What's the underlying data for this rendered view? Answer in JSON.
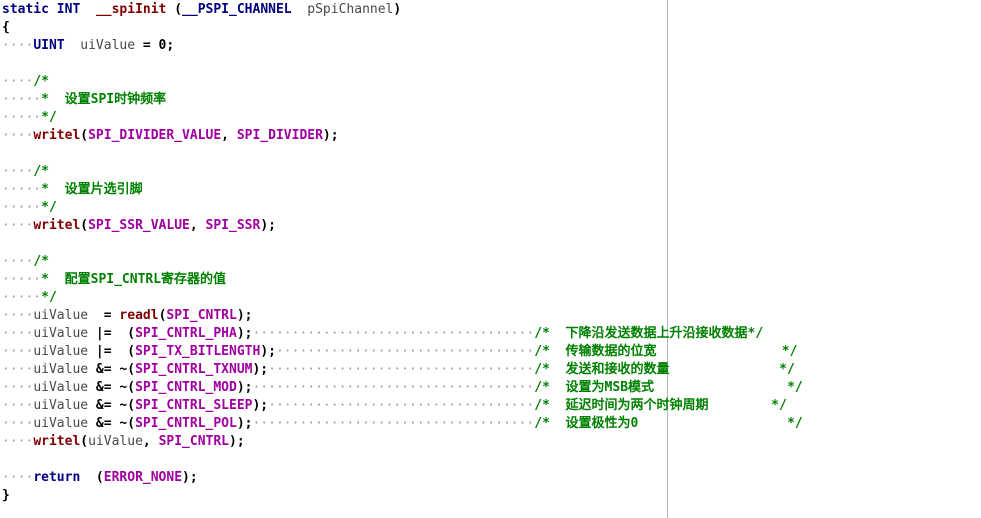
{
  "editor": {
    "lines": [
      {
        "t": [
          {
            "k": "kw",
            "s": "static"
          },
          {
            "k": "op",
            "s": " "
          },
          {
            "k": "kw",
            "s": "INT"
          },
          {
            "k": "op",
            "s": "  "
          },
          {
            "k": "fn",
            "s": "__spiInit"
          },
          {
            "k": "op",
            "s": " ("
          },
          {
            "k": "kw",
            "s": "__PSPI_CHANNEL"
          },
          {
            "k": "op",
            "s": "  "
          },
          {
            "k": "var",
            "s": "pSpiChannel"
          },
          {
            "k": "op",
            "s": ")"
          }
        ]
      },
      {
        "t": [
          {
            "k": "op",
            "s": "{"
          }
        ]
      },
      {
        "t": [
          {
            "k": "dots",
            "s": "····"
          },
          {
            "k": "kw",
            "s": "UINT"
          },
          {
            "k": "op",
            "s": "  "
          },
          {
            "k": "var",
            "s": "uiValue"
          },
          {
            "k": "op",
            "s": " = 0;"
          }
        ]
      },
      {
        "t": []
      },
      {
        "t": [
          {
            "k": "dots",
            "s": "····"
          },
          {
            "k": "cmt",
            "s": "/*"
          }
        ]
      },
      {
        "t": [
          {
            "k": "dots",
            "s": "·····"
          },
          {
            "k": "cmt",
            "s": "*  设置SPI时钟频率"
          }
        ]
      },
      {
        "t": [
          {
            "k": "dots",
            "s": "·····"
          },
          {
            "k": "cmt",
            "s": "*/"
          }
        ]
      },
      {
        "t": [
          {
            "k": "dots",
            "s": "····"
          },
          {
            "k": "fn",
            "s": "writel"
          },
          {
            "k": "op",
            "s": "("
          },
          {
            "k": "mac",
            "s": "SPI_DIVIDER_VALUE"
          },
          {
            "k": "op",
            "s": ", "
          },
          {
            "k": "mac",
            "s": "SPI_DIVIDER"
          },
          {
            "k": "op",
            "s": ");"
          }
        ]
      },
      {
        "t": []
      },
      {
        "t": [
          {
            "k": "dots",
            "s": "····"
          },
          {
            "k": "cmt",
            "s": "/*"
          }
        ]
      },
      {
        "t": [
          {
            "k": "dots",
            "s": "·····"
          },
          {
            "k": "cmt",
            "s": "*  设置片选引脚"
          }
        ]
      },
      {
        "t": [
          {
            "k": "dots",
            "s": "·····"
          },
          {
            "k": "cmt",
            "s": "*/"
          }
        ]
      },
      {
        "t": [
          {
            "k": "dots",
            "s": "····"
          },
          {
            "k": "fn",
            "s": "writel"
          },
          {
            "k": "op",
            "s": "("
          },
          {
            "k": "mac",
            "s": "SPI_SSR_VALUE"
          },
          {
            "k": "op",
            "s": ", "
          },
          {
            "k": "mac",
            "s": "SPI_SSR"
          },
          {
            "k": "op",
            "s": ");"
          }
        ]
      },
      {
        "t": []
      },
      {
        "t": [
          {
            "k": "dots",
            "s": "····"
          },
          {
            "k": "cmt",
            "s": "/*"
          }
        ]
      },
      {
        "t": [
          {
            "k": "dots",
            "s": "·····"
          },
          {
            "k": "cmt",
            "s": "*  配置SPI_CNTRL寄存器的值"
          }
        ]
      },
      {
        "t": [
          {
            "k": "dots",
            "s": "·····"
          },
          {
            "k": "cmt",
            "s": "*/"
          }
        ]
      },
      {
        "t": [
          {
            "k": "dots",
            "s": "····"
          },
          {
            "k": "var",
            "s": "uiValue"
          },
          {
            "k": "op",
            "s": "  = "
          },
          {
            "k": "fn",
            "s": "readl"
          },
          {
            "k": "op",
            "s": "("
          },
          {
            "k": "mac",
            "s": "SPI_CNTRL"
          },
          {
            "k": "op",
            "s": ");"
          }
        ]
      },
      {
        "t": [
          {
            "k": "dots",
            "s": "····"
          },
          {
            "k": "var",
            "s": "uiValue"
          },
          {
            "k": "op",
            "s": " |=  ("
          },
          {
            "k": "mac",
            "s": "SPI_CNTRL_PHA"
          },
          {
            "k": "op",
            "s": ");"
          },
          {
            "k": "dots",
            "s": "····································"
          },
          {
            "k": "cmt",
            "s": "/*  下降沿发送数据上升沿接收数据*/"
          }
        ]
      },
      {
        "t": [
          {
            "k": "dots",
            "s": "····"
          },
          {
            "k": "var",
            "s": "uiValue"
          },
          {
            "k": "op",
            "s": " |=  ("
          },
          {
            "k": "mac",
            "s": "SPI_TX_BITLENGTH"
          },
          {
            "k": "op",
            "s": ");"
          },
          {
            "k": "dots",
            "s": "·································"
          },
          {
            "k": "cmt",
            "s": "/*  传输数据的位宽                */"
          }
        ]
      },
      {
        "t": [
          {
            "k": "dots",
            "s": "····"
          },
          {
            "k": "var",
            "s": "uiValue"
          },
          {
            "k": "op",
            "s": " &= ~("
          },
          {
            "k": "mac",
            "s": "SPI_CNTRL_TXNUM"
          },
          {
            "k": "op",
            "s": ");"
          },
          {
            "k": "dots",
            "s": "··································"
          },
          {
            "k": "cmt",
            "s": "/*  发送和接收的数量              */"
          }
        ]
      },
      {
        "t": [
          {
            "k": "dots",
            "s": "····"
          },
          {
            "k": "var",
            "s": "uiValue"
          },
          {
            "k": "op",
            "s": " &= ~("
          },
          {
            "k": "mac",
            "s": "SPI_CNTRL_MOD"
          },
          {
            "k": "op",
            "s": ");"
          },
          {
            "k": "dots",
            "s": "····································"
          },
          {
            "k": "cmt",
            "s": "/*  设置为MSB模式                 */"
          }
        ]
      },
      {
        "t": [
          {
            "k": "dots",
            "s": "····"
          },
          {
            "k": "var",
            "s": "uiValue"
          },
          {
            "k": "op",
            "s": " &= ~("
          },
          {
            "k": "mac",
            "s": "SPI_CNTRL_SLEEP"
          },
          {
            "k": "op",
            "s": ");"
          },
          {
            "k": "dots",
            "s": "··································"
          },
          {
            "k": "cmt",
            "s": "/*  延迟时间为两个时钟周期        */"
          }
        ]
      },
      {
        "t": [
          {
            "k": "dots",
            "s": "····"
          },
          {
            "k": "var",
            "s": "uiValue"
          },
          {
            "k": "op",
            "s": " &= ~("
          },
          {
            "k": "mac",
            "s": "SPI_CNTRL_POL"
          },
          {
            "k": "op",
            "s": ");"
          },
          {
            "k": "dots",
            "s": "····································"
          },
          {
            "k": "cmt",
            "s": "/*  设置极性为0                   */"
          }
        ]
      },
      {
        "t": [
          {
            "k": "dots",
            "s": "····"
          },
          {
            "k": "fn",
            "s": "writel"
          },
          {
            "k": "op",
            "s": "("
          },
          {
            "k": "var",
            "s": "uiValue"
          },
          {
            "k": "op",
            "s": ", "
          },
          {
            "k": "mac",
            "s": "SPI_CNTRL"
          },
          {
            "k": "op",
            "s": ");"
          }
        ]
      },
      {
        "t": []
      },
      {
        "t": [
          {
            "k": "dots",
            "s": "····"
          },
          {
            "k": "kw",
            "s": "return"
          },
          {
            "k": "op",
            "s": "  ("
          },
          {
            "k": "mac",
            "s": "ERROR_NONE"
          },
          {
            "k": "op",
            "s": ");"
          }
        ]
      },
      {
        "t": [
          {
            "k": "op",
            "s": "}"
          }
        ]
      }
    ]
  }
}
